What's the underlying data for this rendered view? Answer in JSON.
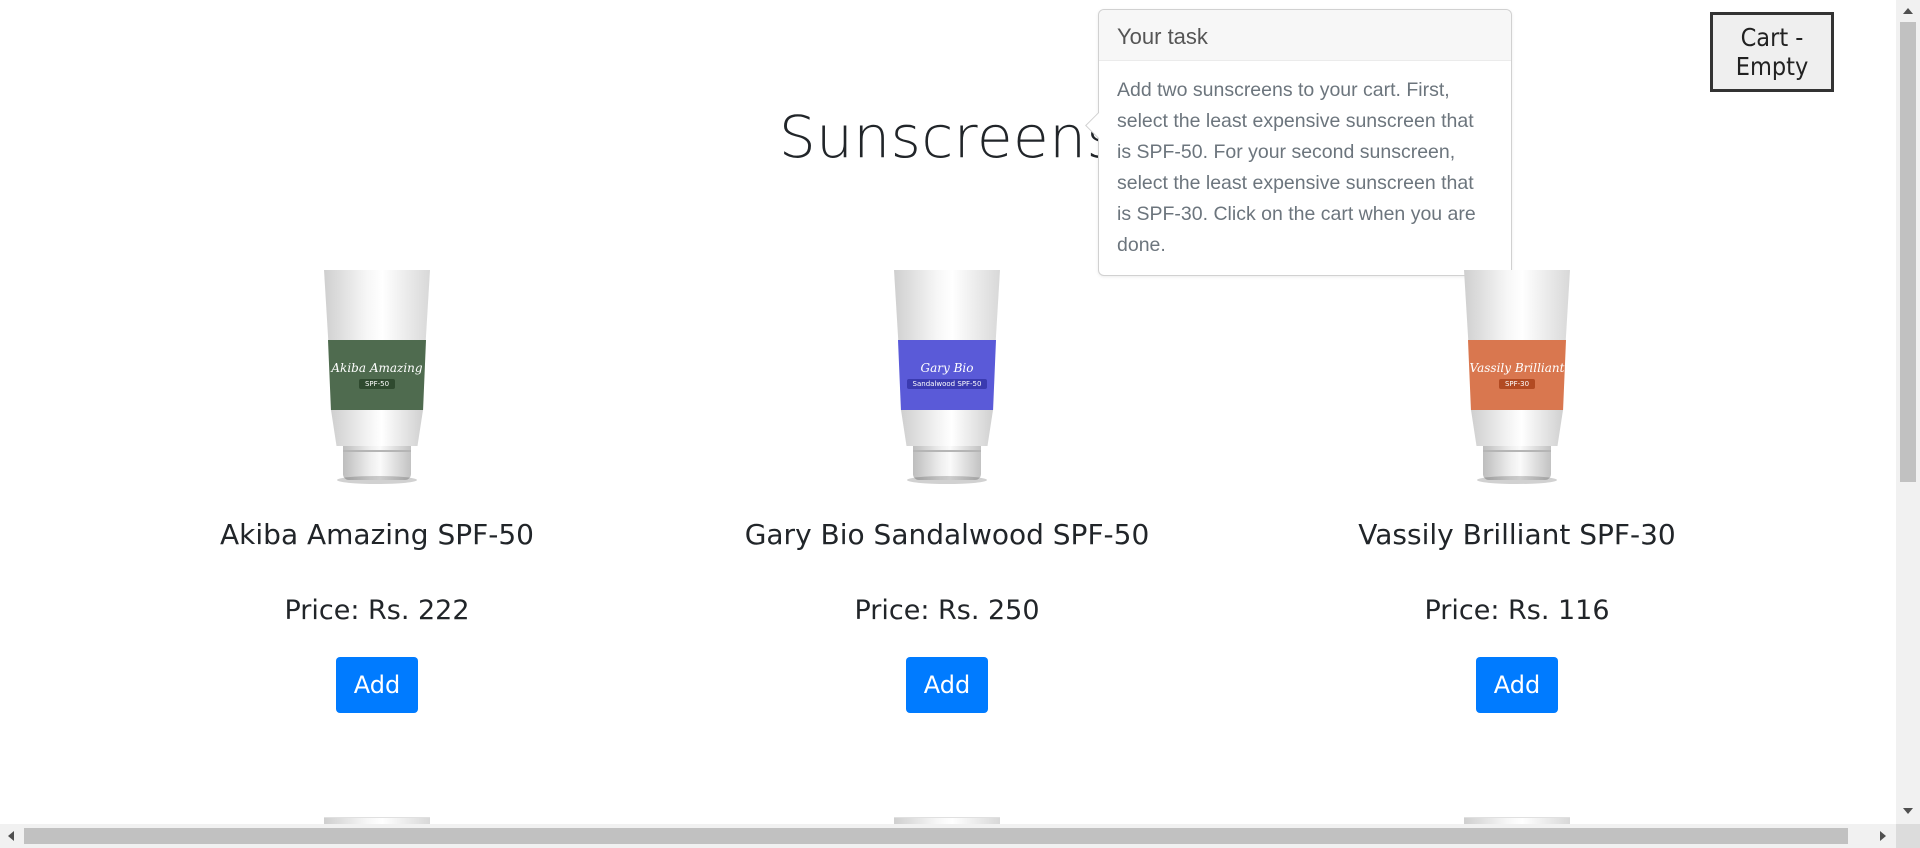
{
  "page": {
    "title": "Sunscreens",
    "info_icon": "info-icon"
  },
  "task_popover": {
    "header": "Your task",
    "body": "Add two sunscreens to your cart. First, select the least expensive sunscreen that is SPF-50. For your second sunscreen, select the least expensive sunscreen that is SPF-30. Click on the cart when you are done."
  },
  "cart": {
    "label": "Cart - Empty"
  },
  "products": [
    {
      "name": "Akiba Amazing SPF-50",
      "price": "Price: Rs. 222",
      "add_label": "Add",
      "tube_brand": "Akiba Amazing",
      "tube_spf": "SPF-50",
      "label_color": "#4f6b4f",
      "tag_color": "#2f4a2f"
    },
    {
      "name": "Gary Bio Sandalwood SPF-50",
      "price": "Price: Rs. 250",
      "add_label": "Add",
      "tube_brand": "Gary Bio",
      "tube_spf": "Sandalwood SPF-50",
      "label_color": "#5a5ad8",
      "tag_color": "#3a3ab0"
    },
    {
      "name": "Vassily Brilliant SPF-30",
      "price": "Price: Rs. 116",
      "add_label": "Add",
      "tube_brand": "Vassily Brilliant",
      "tube_spf": "SPF-30",
      "label_color": "#d9774f",
      "tag_color": "#b24a22"
    }
  ]
}
